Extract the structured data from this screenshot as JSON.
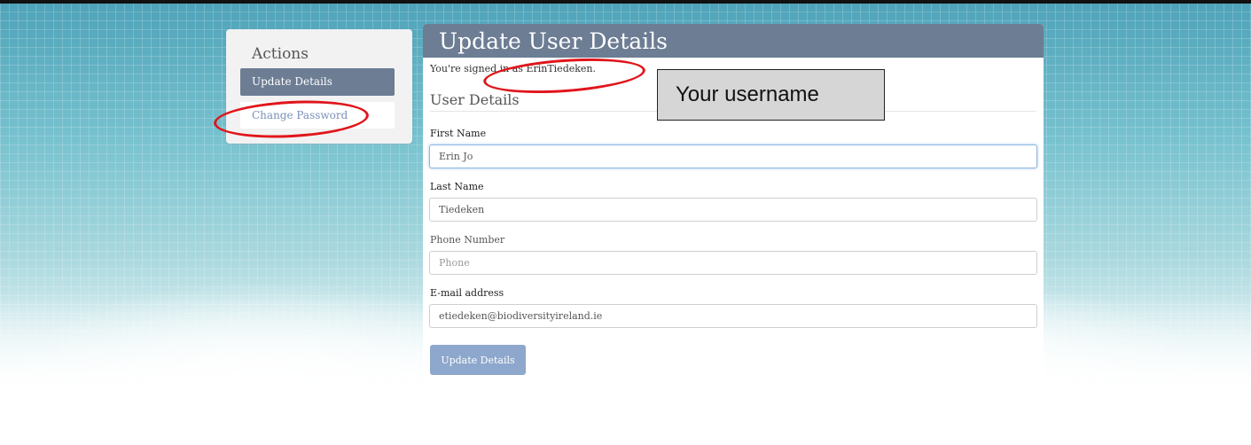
{
  "sidebar": {
    "title": "Actions",
    "items": [
      {
        "label": "Update Details",
        "active": true
      },
      {
        "label": "Change Password",
        "active": false
      }
    ]
  },
  "panel": {
    "title": "Update User Details",
    "signed_in_prefix": "You're signed in as ",
    "username": "ErinTiedeken",
    "signed_in_suffix": ".",
    "section_title": "User Details",
    "fields": {
      "first_name": {
        "label": "First Name",
        "value": "Erin Jo",
        "placeholder": ""
      },
      "last_name": {
        "label": "Last Name",
        "value": "Tiedeken",
        "placeholder": ""
      },
      "phone": {
        "label": "Phone Number",
        "value": "",
        "placeholder": "Phone"
      },
      "email": {
        "label": "E-mail address",
        "value": "etiedeken@biodiversityireland.ie",
        "placeholder": ""
      }
    },
    "submit_label": "Update Details"
  },
  "annotation": {
    "callout_text": "Your username",
    "highlight_color": "#e0151b"
  },
  "colors": {
    "header": "#6c7d94",
    "button": "#8ea7cc",
    "link": "#7a90b8"
  }
}
